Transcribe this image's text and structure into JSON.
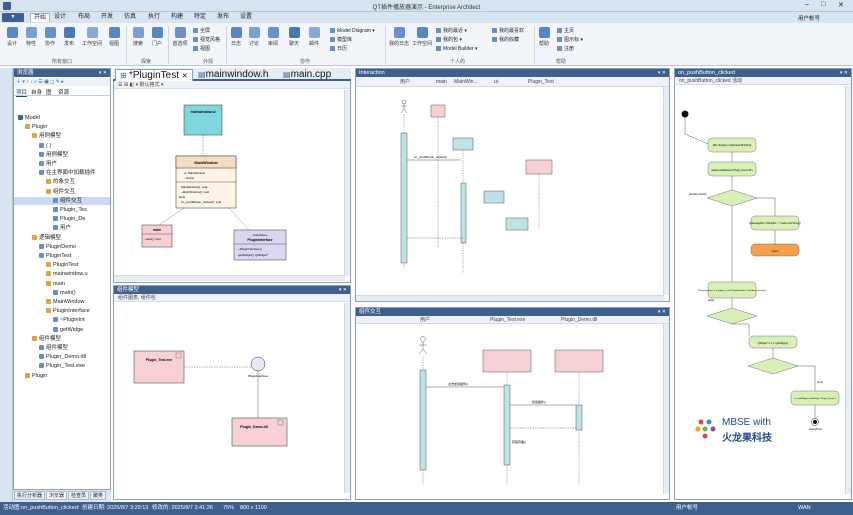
{
  "window": {
    "title": "QT插件播放器演示 - Enterprise Architect",
    "app_menu": "▾",
    "user": "用户帐号"
  },
  "menu": [
    "开始",
    "设计",
    "布局",
    "开发",
    "仿真",
    "执行",
    "构建",
    "特定",
    "发布",
    "设置"
  ],
  "ribbon": {
    "big_buttons": [
      "设计",
      "特性",
      "协作",
      "发布",
      "工作空间",
      "视图",
      "搜索",
      "门户",
      "首选项"
    ],
    "small_a": [
      "全屏",
      "视觉风格",
      "视图"
    ],
    "small_b": [
      "日志",
      "讨论",
      "审阅",
      "聊天",
      "邮件"
    ],
    "model_diagram": "Model Diagram",
    "model_lib": "模型库",
    "calendar": "日历",
    "my_items": [
      "我的最近",
      "我的包",
      "Model Builder"
    ],
    "my_fav": [
      "我的最喜欢",
      "我的收藏"
    ],
    "today": "我的日志",
    "workspace": "工作空间",
    "help": [
      "帮助",
      "主页",
      "图示标",
      "注册"
    ],
    "group_labels": [
      "所有窗口",
      "探索",
      "外观",
      "协作",
      "个人的",
      "帮助"
    ]
  },
  "browser": {
    "title": "浏览器",
    "tabs": [
      "项目",
      "自身",
      "图",
      "资源"
    ],
    "items": [
      {
        "label": "Model",
        "depth": 0
      },
      {
        "label": "Plugin",
        "depth": 1
      },
      {
        "label": "用例模型",
        "depth": 2
      },
      {
        "label": "( )",
        "depth": 3
      },
      {
        "label": "用例模型",
        "depth": 3
      },
      {
        "label": "用户",
        "depth": 3
      },
      {
        "label": "在主界面中加载插件",
        "depth": 3
      },
      {
        "label": "的象交互",
        "depth": 4
      },
      {
        "label": "组件交互",
        "depth": 4
      },
      {
        "label": "组件交互",
        "depth": 5,
        "selected": true
      },
      {
        "label": "Plugin_Tes",
        "depth": 5
      },
      {
        "label": "Plugin_De",
        "depth": 5
      },
      {
        "label": "用户",
        "depth": 5
      },
      {
        "label": "逻辑模型",
        "depth": 2
      },
      {
        "label": "PluginDemo",
        "depth": 3
      },
      {
        "label": "PluginTest",
        "depth": 3
      },
      {
        "label": "PluginTest",
        "depth": 4
      },
      {
        "label": "mainwindow.u",
        "depth": 4
      },
      {
        "label": "main",
        "depth": 4
      },
      {
        "label": "main()",
        "depth": 5
      },
      {
        "label": "MainWindow",
        "depth": 4
      },
      {
        "label": "PluginInterface",
        "depth": 4
      },
      {
        "label": "~PluginInt",
        "depth": 5
      },
      {
        "label": "getWidge",
        "depth": 5
      },
      {
        "label": "组件模型",
        "depth": 2
      },
      {
        "label": "组件模型",
        "depth": 3
      },
      {
        "label": "Plugin_Demo.dll",
        "depth": 3
      },
      {
        "label": "Plugin_Test.exe",
        "depth": 3
      },
      {
        "label": "Plugin",
        "depth": 1
      }
    ],
    "bottom_tabs": [
      "执行分析器",
      "浏览器",
      "检查员",
      "聚类"
    ]
  },
  "doc_tabs": [
    "*PluginTest",
    "mainwindow.h",
    "main.cpp"
  ],
  "class_diagram": {
    "toolbar": "默认格式",
    "mainwindow_ui": "mainwindow.ui",
    "mainwindow": "MainWindow",
    "mw_attrs": [
      "ui: MainWindow",
      "- button"
    ],
    "mw_ops": [
      "MainWindow(): void",
      "~MainWindow(): void",
      "slots",
      "on_pushButton_clicked(): void"
    ],
    "main": "main",
    "main_op": "main(): void",
    "iface_stereo": "«interface»",
    "iface": "PluginInterface",
    "iface_ops": [
      "~PluginInterface()",
      "getWidget(): QWidget*"
    ]
  },
  "interaction": {
    "title": "Interaction",
    "lifelines": [
      "用户",
      "main",
      "MainWin...",
      "ui",
      "Plugin_Test"
    ],
    "msg": "on_pushButton_clicked()"
  },
  "component": {
    "title": "组件模型",
    "toolbar": "组件图表, 组件包",
    "exe": "Plugin_Test.exe",
    "iface": "PluginInterface",
    "dll": "Plugin_Demo.dll"
  },
  "comp_interaction": {
    "title": "组件交互",
    "lifelines": [
      "用户",
      "Plugin_Test.exe",
      "Plugin_Demo.dll"
    ],
    "msgs": [
      "点击加载插件()",
      "加载插件()",
      "获取界面()"
    ]
  },
  "activity": {
    "title": "on_pushButton_clicked",
    "toolbar": "on_pushButton_clicked 活动",
    "n1": "QDir dir(qApp->applicationDirPath())",
    "n2": "loader.setFileName(\"Plugin_Demo.dll\")",
    "d1": "if(loader.load())",
    "n3": "QMessageBox::critical(this, \"\", loader.errorString())",
    "n4": "return",
    "n5": "PluginInterface* p = qobject_cast<PluginInterface*>(loader.instance())",
    "n6": "QWidget* w = p->getWidget()",
    "n7": "ui->tabWidget->addTab(w, \"Plugin_Demo\")",
    "else1": "[else]",
    "yes": "[true]",
    "final": "ActivityFinal"
  },
  "watermark": {
    "line1": "MBSE with",
    "line2": "火龙果科技"
  },
  "status": {
    "left": "活动图:on_pushButton_clicked:",
    "created": "创建日期: 2025/8/7 3:29:13",
    "modified": "修改的: 2025/8/7 3:41:26",
    "zoom": "75%",
    "size": "800 x 1100",
    "right1": "用户帐号",
    "right2": "WAN"
  }
}
